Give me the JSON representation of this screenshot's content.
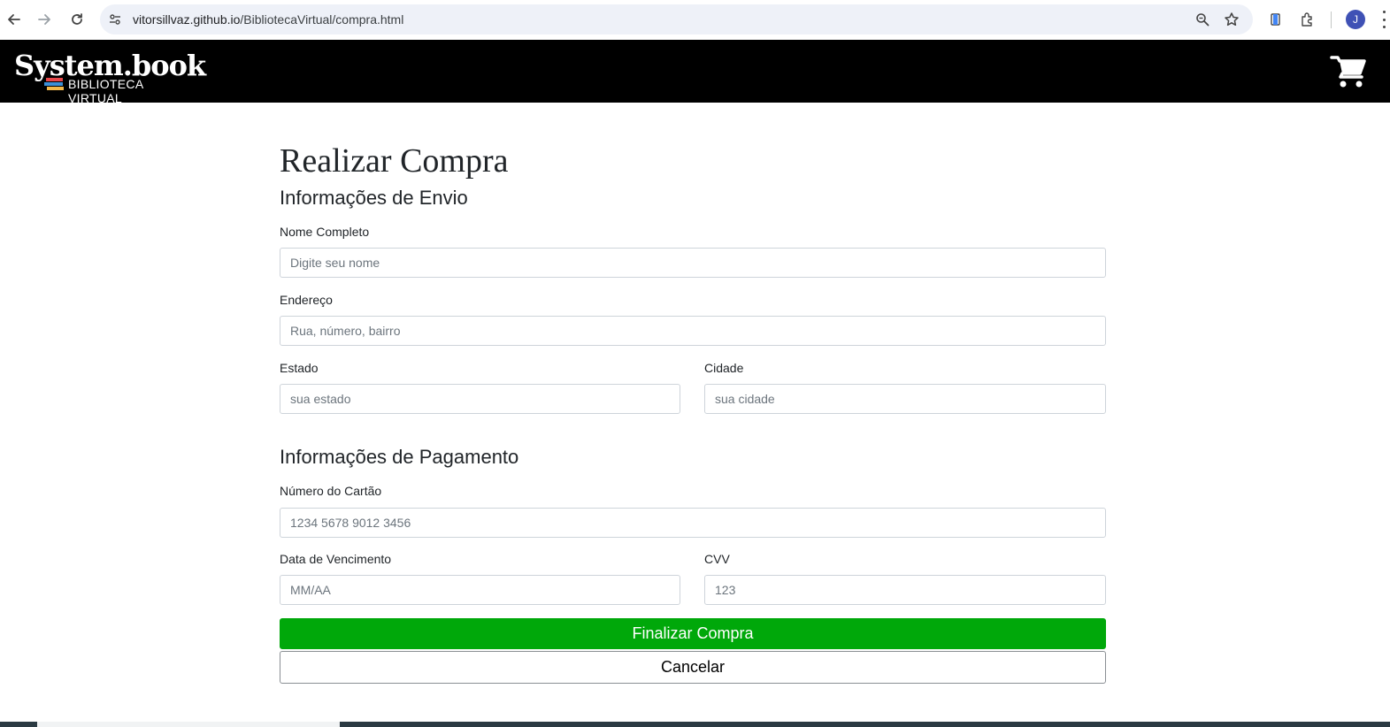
{
  "browser": {
    "url_host": "vitorsillvaz.github.io",
    "url_path": "/BibliotecaVirtual/compra.html",
    "profile_initial": "J",
    "icons": [
      "back-icon",
      "forward-icon",
      "reload-icon",
      "site-settings-icon",
      "zoom-icon",
      "bookmark-star-icon",
      "reading-list-icon",
      "extensions-icon",
      "menu-icon"
    ]
  },
  "header": {
    "logo_title": "System.book",
    "logo_subtitle": "BIBLIOTECA VIRTUAL",
    "cart_icon": "cart-icon",
    "background_color": "#000000"
  },
  "form": {
    "title": "Realizar Compra",
    "shipping": {
      "heading": "Informações de Envio",
      "name_label": "Nome Completo",
      "name_placeholder": "Digite seu nome",
      "address_label": "Endereço",
      "address_placeholder": "Rua, número, bairro",
      "state_label": "Estado",
      "state_placeholder": "sua estado",
      "city_label": "Cidade",
      "city_placeholder": "sua cidade"
    },
    "payment": {
      "heading": "Informações de Pagamento",
      "card_label": "Número do Cartão",
      "card_placeholder": "1234 5678 9012 3456",
      "expiry_label": "Data de Vencimento",
      "expiry_placeholder": "MM/AA",
      "cvv_label": "CVV",
      "cvv_placeholder": "123"
    },
    "submit_label": "Finalizar Compra",
    "cancel_label": "Cancelar",
    "submit_color": "#00a80a"
  }
}
